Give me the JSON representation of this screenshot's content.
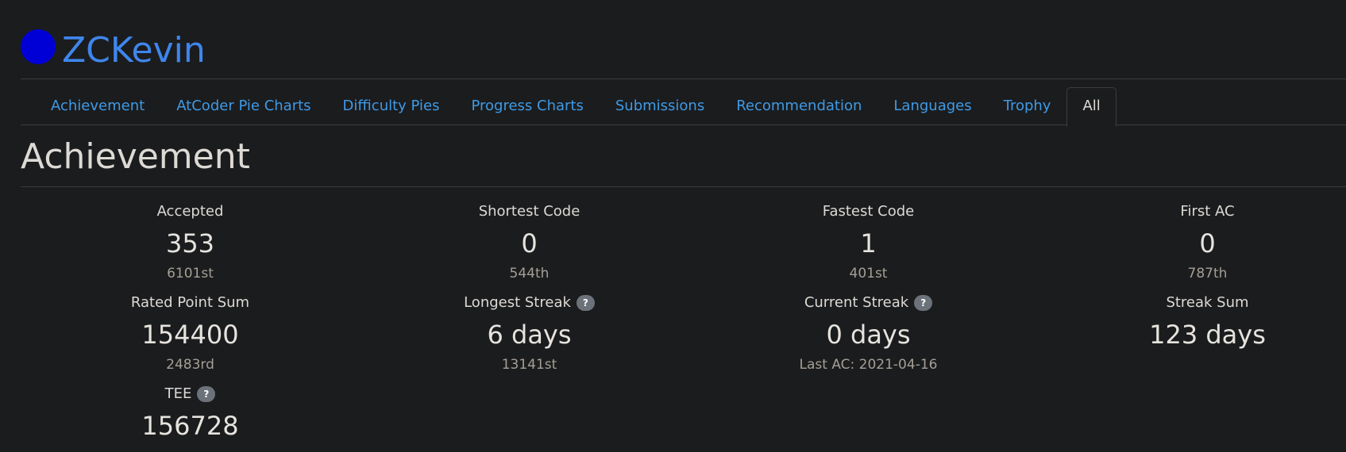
{
  "user": {
    "name": "ZCKevin",
    "avatar_color": "#0000d6"
  },
  "tabs": [
    {
      "label": "Achievement"
    },
    {
      "label": "AtCoder Pie Charts"
    },
    {
      "label": "Difficulty Pies"
    },
    {
      "label": "Progress Charts"
    },
    {
      "label": "Submissions"
    },
    {
      "label": "Recommendation"
    },
    {
      "label": "Languages"
    },
    {
      "label": "Trophy"
    },
    {
      "label": "All"
    }
  ],
  "section": {
    "title": "Achievement"
  },
  "stats": [
    {
      "title": "Accepted",
      "value": "353",
      "sub": "6101st"
    },
    {
      "title": "Shortest Code",
      "value": "0",
      "sub": "544th"
    },
    {
      "title": "Fastest Code",
      "value": "1",
      "sub": "401st"
    },
    {
      "title": "First AC",
      "value": "0",
      "sub": "787th"
    },
    {
      "title": "Rated Point Sum",
      "value": "154400",
      "sub": "2483rd"
    },
    {
      "title": "Longest Streak",
      "value": "6 days",
      "sub": "13141st",
      "help": "?"
    },
    {
      "title": "Current Streak",
      "value": "0 days",
      "sub": "Last AC: 2021-04-16",
      "help": "?"
    },
    {
      "title": "Streak Sum",
      "value": "123 days"
    },
    {
      "title": "TEE",
      "value": "156728",
      "help": "?"
    }
  ],
  "colors": {
    "accent": "#3f86ec",
    "link": "#3f9ae6",
    "background": "#1b1c1e"
  }
}
